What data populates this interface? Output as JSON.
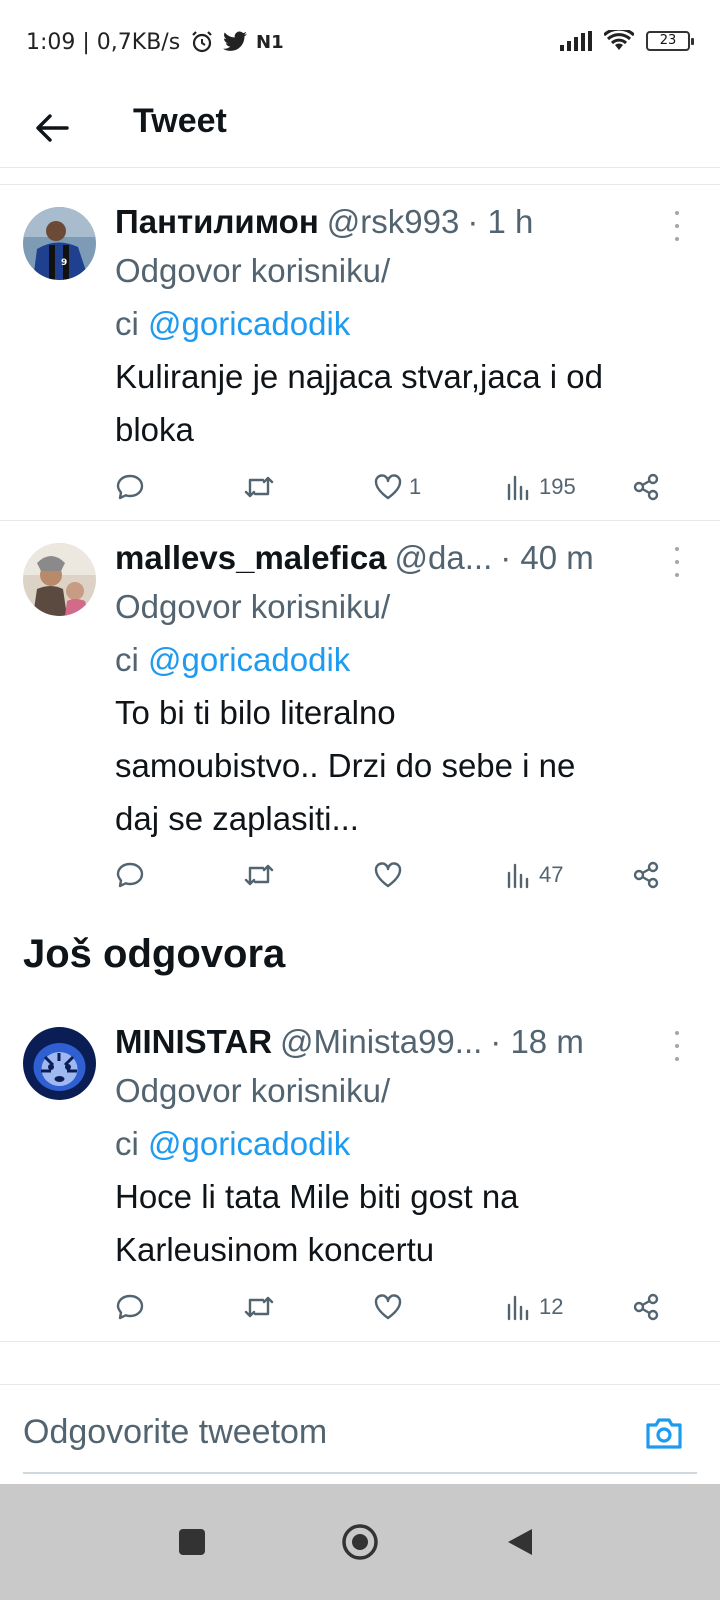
{
  "status_bar": {
    "text": "1:09 | 0,7KB/s",
    "battery": "23",
    "icons": [
      "alarm-icon",
      "twitter-icon",
      "n1-icon",
      "signal-icon",
      "wifi-icon",
      "battery-icon"
    ],
    "n1_label": "N1"
  },
  "header": {
    "title": "Tweet"
  },
  "tweets": [
    {
      "name": "Пантилимон",
      "handle": "@rsk993",
      "time": "· 1 h",
      "reply_prefix": "Odgovor korisniku/",
      "reply_prefix2": "ci",
      "reply_mention": "@goricadodik",
      "text_line1": "Kuliranje je najjaca stvar,jaca i od",
      "text_line2": "bloka",
      "likes": "1",
      "views": "195"
    },
    {
      "name": "mallevs_malefica",
      "handle": "@da...",
      "time": "· 40 m",
      "reply_prefix": "Odgovor korisniku/",
      "reply_prefix2": "ci",
      "reply_mention": "@goricadodik",
      "text_line1": "To bi ti bilo literalno",
      "text_line2": "samoubistvo.. Drzi do sebe i ne",
      "text_line3": "daj se zaplasiti...",
      "likes": "",
      "views": "47"
    },
    {
      "name": "MINISTAR",
      "handle": "@Minista99...",
      "time": "· 18 m",
      "reply_prefix": "Odgovor korisniku/",
      "reply_prefix2": "ci",
      "reply_mention": "@goricadodik",
      "text_line1": "Hoce li tata Mile biti gost na",
      "text_line2": "Karleusinom koncertu",
      "likes": "",
      "views": "12"
    }
  ],
  "section": {
    "more_replies": "Još odgovora"
  },
  "compose": {
    "placeholder": "Odgovorite tweetom"
  },
  "colors": {
    "accent": "#1d9bf0",
    "text_primary": "#0f1419",
    "text_secondary": "#536471",
    "divider": "#e6e9ec",
    "navbar": "#c9c9c9"
  }
}
